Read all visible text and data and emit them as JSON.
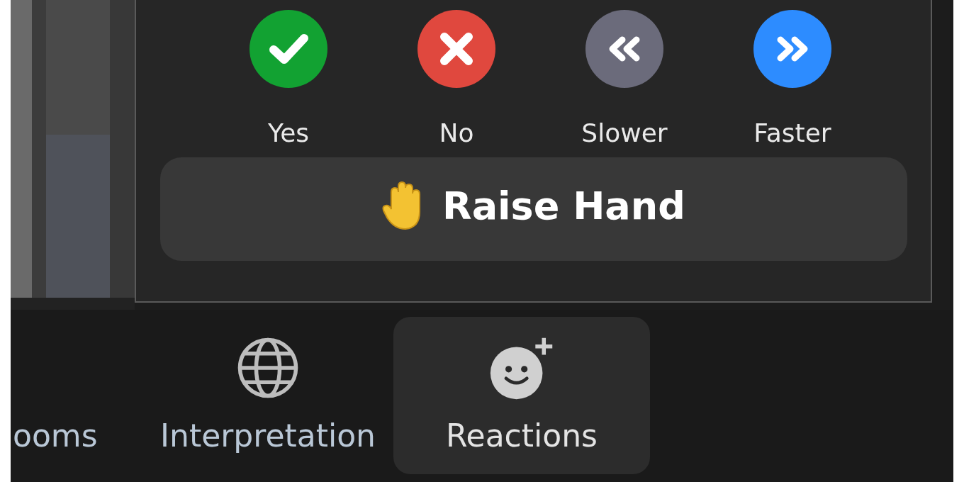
{
  "reactions": [
    {
      "label": "Yes",
      "kind": "yes",
      "color": "#12a232"
    },
    {
      "label": "No",
      "kind": "no",
      "color": "#e0483e"
    },
    {
      "label": "Slower",
      "kind": "slower",
      "color": "#6b6b7b"
    },
    {
      "label": "Faster",
      "kind": "faster",
      "color": "#2d8cff"
    }
  ],
  "raise_hand": {
    "label": "Raise Hand"
  },
  "toolbar": [
    {
      "label": "ooms",
      "kind": "cut",
      "selected": false
    },
    {
      "label": "Interpretation",
      "kind": "globe",
      "selected": false
    },
    {
      "label": "Reactions",
      "kind": "reactions",
      "selected": true
    }
  ]
}
